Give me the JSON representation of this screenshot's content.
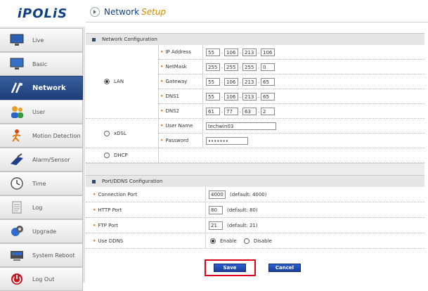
{
  "brand": {
    "logo_text": "iPOLiS"
  },
  "header": {
    "title_part1": "Network",
    "title_part2": "Setup"
  },
  "sidebar": {
    "items": [
      {
        "label": "Live"
      },
      {
        "label": "Basic"
      },
      {
        "label": "Network"
      },
      {
        "label": "User"
      },
      {
        "label": "Motion Detection"
      },
      {
        "label": "Alarm/Sensor"
      },
      {
        "label": "Time"
      },
      {
        "label": "Log"
      },
      {
        "label": "Upgrade"
      },
      {
        "label": "System Reboot"
      },
      {
        "label": "Log Out"
      }
    ],
    "active_index": 2
  },
  "network_config": {
    "title": "Network Configuration",
    "lan": {
      "label": "LAN",
      "selected": true,
      "fields": [
        {
          "label": "IP Address",
          "octets": [
            "55",
            "106",
            "213",
            "106"
          ]
        },
        {
          "label": "NetMask",
          "octets": [
            "255",
            "255",
            "255",
            "0"
          ]
        },
        {
          "label": "Gateway",
          "octets": [
            "55",
            "106",
            "213",
            "65"
          ]
        },
        {
          "label": "DNS1",
          "octets": [
            "55",
            "106",
            "213",
            "65"
          ]
        },
        {
          "label": "DNS2",
          "octets": [
            "61",
            "77",
            "63",
            "2"
          ]
        }
      ]
    },
    "xdsl": {
      "label": "xDSL",
      "selected": false,
      "user_name_label": "User Name",
      "user_name_value": "techwin03",
      "password_label": "Password",
      "password_value": "•••••••"
    },
    "dhcp": {
      "label": "DHCP",
      "selected": false
    },
    "ip_separator": "."
  },
  "port_config": {
    "title": "Port/DDNS Configuration",
    "connection_port": {
      "label": "Connection Port",
      "value": "4000",
      "default_text": "(default: 4000)"
    },
    "http_port": {
      "label": "HTTP Port",
      "value": "80",
      "default_text": "(default: 80)"
    },
    "ftp_port": {
      "label": "FTP Port",
      "value": "21",
      "default_text": "(default: 21)"
    },
    "use_ddns": {
      "label": "Use DDNS",
      "enable_label": "Enable",
      "disable_label": "Disable",
      "selected": "Enable"
    }
  },
  "buttons": {
    "save": "Save",
    "cancel": "Cancel"
  },
  "colors": {
    "accent": "#0d3f86",
    "highlight": "#e0001a",
    "setup_text": "#d38a00",
    "button": "#1b3f9a"
  }
}
